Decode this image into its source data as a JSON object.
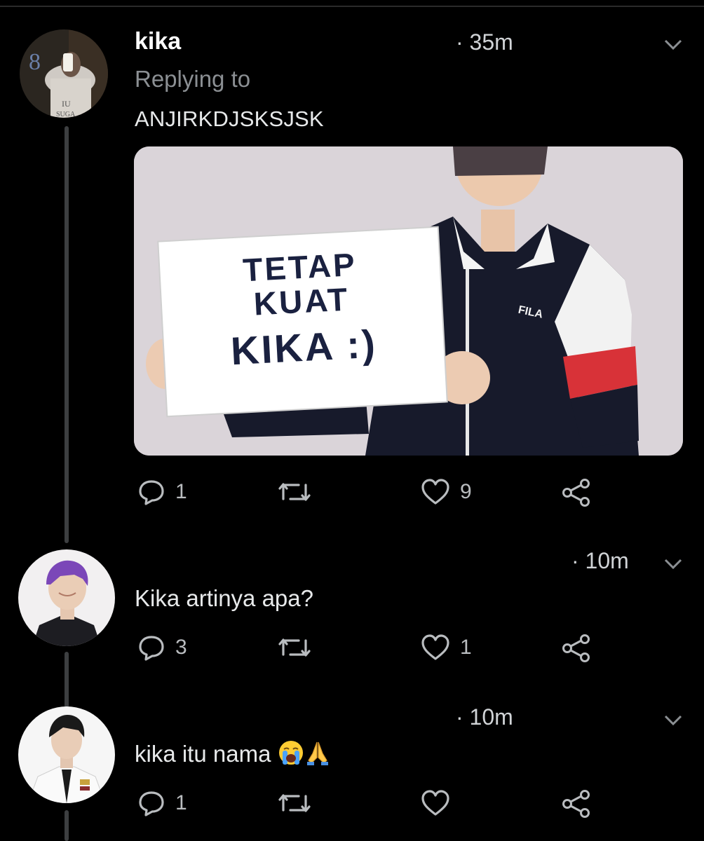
{
  "tweets": [
    {
      "author": "kika",
      "replying_to_label": "Replying to",
      "replying_to_handle": "ANJIRKDJSKSJSK",
      "time": "· 35m",
      "media": {
        "sign_lines": [
          "TETAP",
          "KUAT",
          "KIKA :)"
        ],
        "jacket_logo": "FILA"
      },
      "actions": {
        "replies": "1",
        "retweets": "",
        "likes": "9"
      }
    },
    {
      "text": "Kika artinya apa?",
      "time": "· 10m",
      "actions": {
        "replies": "3",
        "retweets": "",
        "likes": "1"
      }
    },
    {
      "text": "kika itu nama",
      "emoji": [
        "loudly-crying-face",
        "folded-hands"
      ],
      "time": "· 10m",
      "actions": {
        "replies": "1",
        "retweets": "",
        "likes": ""
      }
    }
  ],
  "icons": [
    "reply-icon",
    "retweet-icon",
    "like-icon",
    "share-icon",
    "chevron-down-icon"
  ],
  "colors": {
    "background": "#000000",
    "text": "#e7e9ea",
    "muted": "#8b8f93",
    "thread_line": "#3d3f41",
    "sign_text": "#1a2140"
  }
}
